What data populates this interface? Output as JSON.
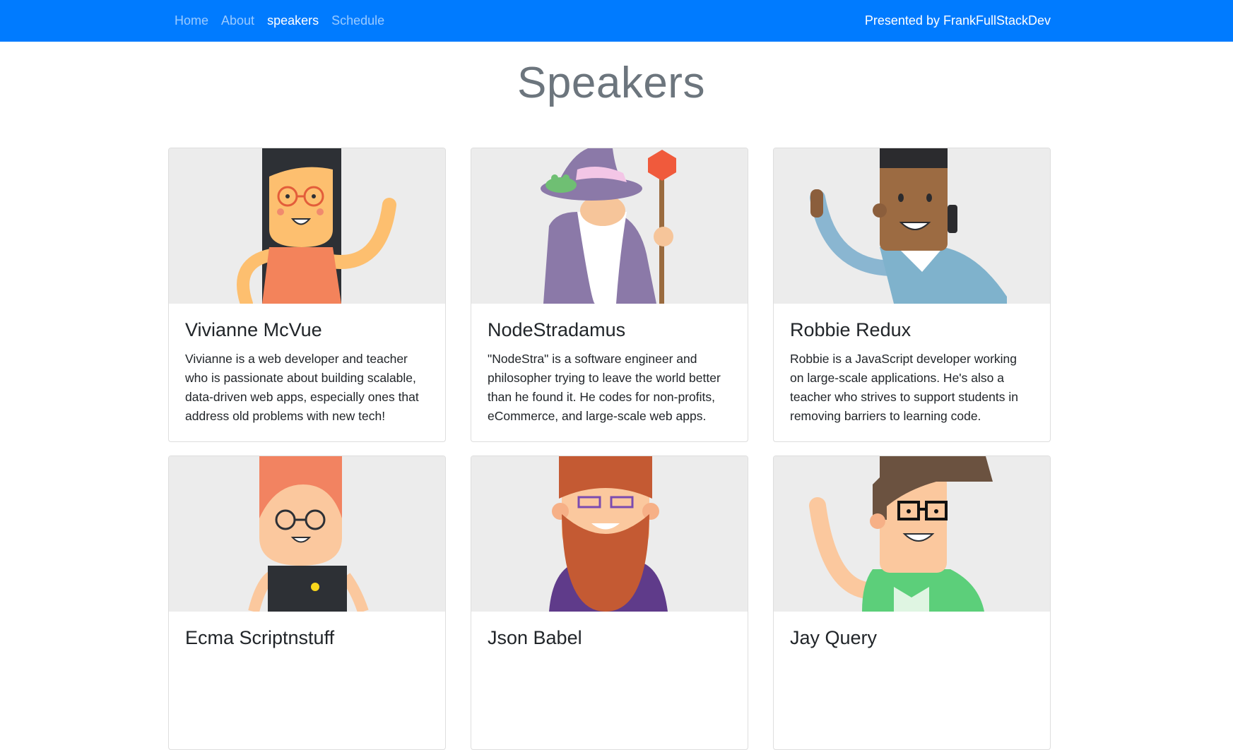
{
  "nav": {
    "links": [
      {
        "label": "Home",
        "active": false
      },
      {
        "label": "About",
        "active": false
      },
      {
        "label": "speakers",
        "active": true
      },
      {
        "label": "Schedule",
        "active": false
      }
    ],
    "presented_by": "Presented by FrankFullStackDev"
  },
  "page": {
    "title": "Speakers"
  },
  "speakers": [
    {
      "name": "Vivianne McVue",
      "bio": "Vivianne is a web developer and teacher who is passionate about building scalable, data-driven web apps, especially ones that address old problems with new tech!",
      "avatar": "woman-glasses-avatar"
    },
    {
      "name": "NodeStradamus",
      "bio": "\"NodeStra\" is a software engineer and philosopher trying to leave the world better than he found it. He codes for non-profits, eCommerce, and large-scale web apps.",
      "avatar": "wizard-avatar"
    },
    {
      "name": "Robbie Redux",
      "bio": "Robbie is a JavaScript developer working on large-scale applications. He's also a teacher who strives to support students in removing barriers to learning code.",
      "avatar": "man-phone-avatar"
    },
    {
      "name": "Ecma Scriptnstuff",
      "bio": "",
      "avatar": "redhead-glasses-avatar"
    },
    {
      "name": "Json Babel",
      "bio": "",
      "avatar": "bearded-man-avatar"
    },
    {
      "name": "Jay Query",
      "bio": "",
      "avatar": "man-glasses-avatar"
    }
  ],
  "colors": {
    "navbar": "#007bff",
    "card_image_bg": "#ececec",
    "title": "#6c757d"
  }
}
